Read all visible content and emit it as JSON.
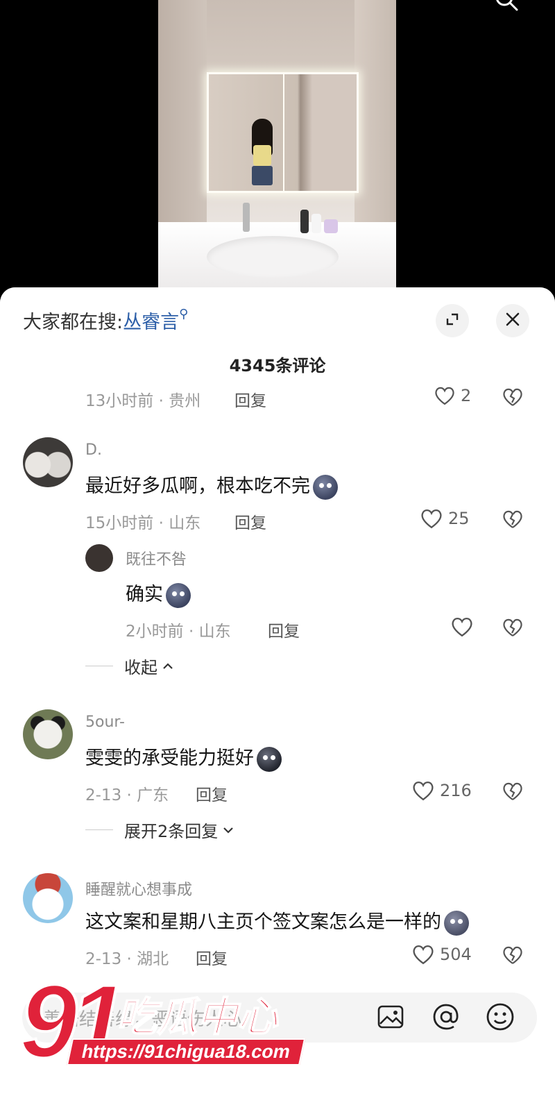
{
  "header": {
    "trending_prefix": "大家都在搜:",
    "trending_keyword": "丛睿言",
    "comment_count_title": "4345条评论"
  },
  "comments": [
    {
      "meta": "13小时前 · 贵州",
      "reply": "回复",
      "likes": "2"
    },
    {
      "user": "D.",
      "text": "最近好多瓜啊，根本吃不完",
      "meta": "15小时前 · 山东",
      "reply": "回复",
      "likes": "25",
      "sub": {
        "user": "既往不咎",
        "text": "确实",
        "meta": "2小时前 · 山东",
        "reply": "回复"
      },
      "toggle": "收起"
    },
    {
      "user": "5our-",
      "text": "雯雯的承受能力挺好",
      "meta": "2-13 · 广东",
      "reply": "回复",
      "likes": "216",
      "toggle": "展开2条回复"
    },
    {
      "user": "睡醒就心想事成",
      "text": "这文案和星期八主页个签文案怎么是一样的",
      "meta": "2-13 · 湖北",
      "reply": "回复",
      "likes": "504"
    }
  ],
  "input": {
    "placeholder": "善语结善缘，恶语伤人心"
  },
  "watermark": {
    "number": "91",
    "name": "吃瓜中心",
    "url": "https://91chigua18.com"
  },
  "icons": [
    "search-icon",
    "collapse-icon",
    "close-icon",
    "heart-icon",
    "broken-heart-icon",
    "image-icon",
    "at-icon",
    "emoji-icon",
    "chevron-up-icon",
    "chevron-down-icon"
  ],
  "colors": {
    "link": "#2d5fa8",
    "watermark": "#e0223a"
  }
}
